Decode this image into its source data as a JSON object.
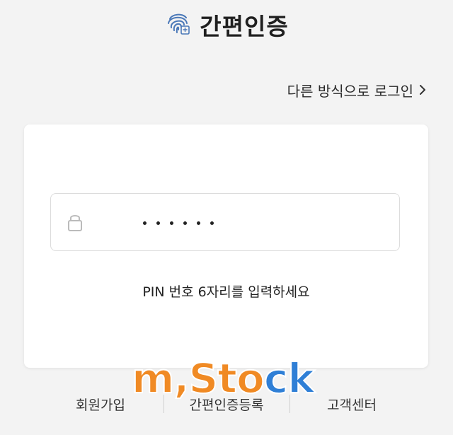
{
  "header": {
    "title": "간편인증",
    "icon": "fingerprint-icon",
    "icon_color": "#4a78b8"
  },
  "alt_login": {
    "label": "다른 방식으로 로그인",
    "icon": "chevron-right-icon"
  },
  "pin": {
    "lock_icon": "lock-icon",
    "filled_count": 6,
    "helper_text": "PIN 번호 6자리를 입력하세요"
  },
  "footer": {
    "links": [
      "회원가입",
      "간편인증등록",
      "고객센터"
    ]
  },
  "watermark": {
    "part1": "m",
    "part2": ",Sto",
    "part3": "ck"
  },
  "colors": {
    "background": "#f3f3f3",
    "card": "#ffffff",
    "brand_orange": "#f08a24",
    "brand_blue": "#2f7fd6"
  }
}
